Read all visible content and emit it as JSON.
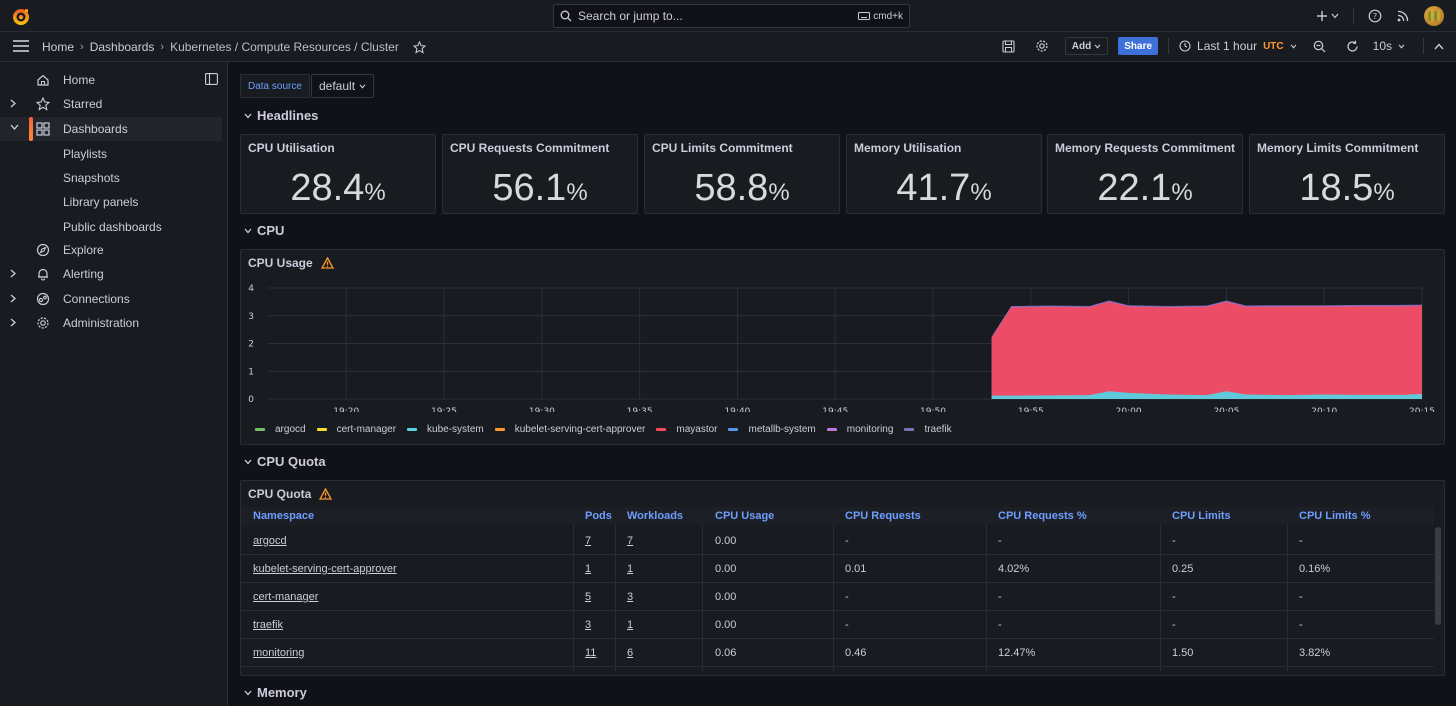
{
  "search": {
    "placeholder": "Search or jump to...",
    "shortcut": "cmd+k"
  },
  "breadcrumbs": [
    "Home",
    "Dashboards",
    "Kubernetes / Compute Resources / Cluster"
  ],
  "toolbar": {
    "add_label": "Add",
    "share_label": "Share",
    "time_range": "Last 1 hour",
    "timezone": "UTC",
    "refresh": "10s"
  },
  "sidebar": {
    "items": [
      {
        "label": "Home",
        "icon": "home-icon"
      },
      {
        "label": "Starred",
        "icon": "star-icon"
      },
      {
        "label": "Dashboards",
        "icon": "apps-icon"
      },
      {
        "label": "Explore",
        "icon": "compass-icon"
      },
      {
        "label": "Alerting",
        "icon": "bell-icon"
      },
      {
        "label": "Connections",
        "icon": "connections-icon"
      },
      {
        "label": "Administration",
        "icon": "gear-icon"
      }
    ],
    "dashboards_children": [
      "Playlists",
      "Snapshots",
      "Library panels",
      "Public dashboards"
    ]
  },
  "variables": {
    "datasource_label": "Data source",
    "datasource_value": "default"
  },
  "rows": {
    "headlines": "Headlines",
    "cpu": "CPU",
    "cpu_quota": "CPU Quota",
    "memory": "Memory"
  },
  "stats": [
    {
      "title": "CPU Utilisation",
      "value": "28.4",
      "unit": "%"
    },
    {
      "title": "CPU Requests Commitment",
      "value": "56.1",
      "unit": "%"
    },
    {
      "title": "CPU Limits Commitment",
      "value": "58.8",
      "unit": "%"
    },
    {
      "title": "Memory Utilisation",
      "value": "41.7",
      "unit": "%"
    },
    {
      "title": "Memory Requests Commitment",
      "value": "22.1",
      "unit": "%"
    },
    {
      "title": "Memory Limits Commitment",
      "value": "18.5",
      "unit": "%"
    }
  ],
  "cpu_usage_panel": {
    "title": "CPU Usage"
  },
  "chart_data": {
    "type": "area",
    "title": "CPU Usage",
    "x_ticks": [
      "19:20",
      "19:25",
      "19:30",
      "19:35",
      "19:40",
      "19:45",
      "19:50",
      "19:55",
      "20:00",
      "20:05",
      "20:10",
      "20:15"
    ],
    "y_ticks": [
      "0",
      "1",
      "2",
      "3",
      "4"
    ],
    "ylim": [
      0,
      4
    ],
    "grid": true,
    "legend_position": "bottom",
    "series": [
      {
        "name": "argocd",
        "color": "#73bf69"
      },
      {
        "name": "cert-manager",
        "color": "#fade2a"
      },
      {
        "name": "kube-system",
        "color": "#5ad1e0",
        "x": [
          "19:53",
          "19:54",
          "19:56",
          "19:58",
          "19:59",
          "20:00",
          "20:02",
          "20:04",
          "20:05",
          "20:06",
          "20:08",
          "20:10",
          "20:12",
          "20:14",
          "20:15"
        ],
        "values": [
          0.12,
          0.12,
          0.13,
          0.14,
          0.28,
          0.22,
          0.16,
          0.14,
          0.28,
          0.16,
          0.14,
          0.16,
          0.15,
          0.15,
          0.18
        ]
      },
      {
        "name": "kubelet-serving-cert-approver",
        "color": "#ff9830"
      },
      {
        "name": "mayastor",
        "color": "#f2495c",
        "x": [
          "19:53",
          "19:54",
          "19:56",
          "19:58",
          "19:59",
          "20:00",
          "20:02",
          "20:04",
          "20:05",
          "20:06",
          "20:08",
          "20:10",
          "20:12",
          "20:14",
          "20:15"
        ],
        "values": [
          2.2,
          3.3,
          3.32,
          3.3,
          3.5,
          3.33,
          3.3,
          3.32,
          3.5,
          3.32,
          3.33,
          3.33,
          3.34,
          3.34,
          3.35
        ]
      },
      {
        "name": "metallb-system",
        "color": "#5794f2"
      },
      {
        "name": "monitoring",
        "color": "#b877d9"
      },
      {
        "name": "traefik",
        "color": "#806eb7"
      }
    ]
  },
  "cpu_quota_panel": {
    "title": "CPU Quota",
    "columns": [
      "Namespace",
      "Pods",
      "Workloads",
      "CPU Usage",
      "CPU Requests",
      "CPU Requests %",
      "CPU Limits",
      "CPU Limits %"
    ],
    "rows": [
      [
        "argocd",
        "7",
        "7",
        "0.00",
        "-",
        "-",
        "-",
        "-"
      ],
      [
        "kubelet-serving-cert-approver",
        "1",
        "1",
        "0.00",
        "0.01",
        "4.02%",
        "0.25",
        "0.16%"
      ],
      [
        "cert-manager",
        "5",
        "3",
        "0.00",
        "-",
        "-",
        "-",
        "-"
      ],
      [
        "traefik",
        "3",
        "1",
        "0.00",
        "-",
        "-",
        "-",
        "-"
      ],
      [
        "monitoring",
        "11",
        "6",
        "0.06",
        "0.46",
        "12.47%",
        "1.50",
        "3.82%"
      ]
    ]
  }
}
